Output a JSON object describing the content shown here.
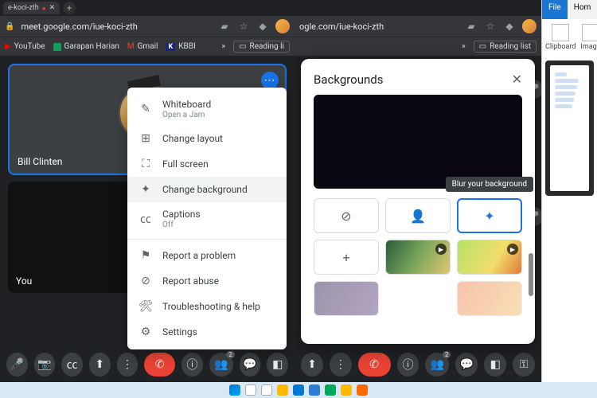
{
  "browser": {
    "tab_partial": "e-koci-zth",
    "url": "meet.google.com/iue-koci-zth",
    "url_partial": "ogle.com/iue-koci-zth",
    "reading_list": "Reading list",
    "reading_list_short": "Reading li",
    "bookmarks": [
      "YouTube",
      "Garapan Harian",
      "Gmail",
      "KBBI"
    ]
  },
  "tiles": {
    "participant": "Bill Clinten",
    "self": "You"
  },
  "menu": {
    "whiteboard": "Whiteboard",
    "whiteboard_sub": "Open a Jam",
    "change_layout": "Change layout",
    "full_screen": "Full screen",
    "change_background": "Change background",
    "captions": "Captions",
    "captions_sub": "Off",
    "report_problem": "Report a problem",
    "report_abuse": "Report abuse",
    "troubleshoot": "Troubleshooting & help",
    "settings": "Settings"
  },
  "backgrounds": {
    "title": "Backgrounds",
    "tooltip": "Blur your background"
  },
  "bottombar": {
    "participants_count": "2"
  },
  "ribbon": {
    "file": "File",
    "home": "Hom",
    "clipboard": "Clipboard",
    "image": "Image"
  }
}
